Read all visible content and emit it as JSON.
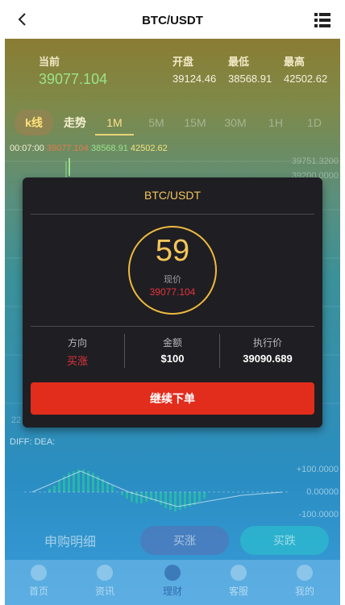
{
  "header": {
    "title": "BTC/USDT",
    "back_icon": "chevron-left-icon",
    "menu_icon": "list-menu-icon"
  },
  "stats": {
    "current_label": "当前",
    "current_value": "39077.104",
    "open_label": "开盘",
    "open_value": "39124.46",
    "low_label": "最低",
    "low_value": "38568.91",
    "high_label": "最高",
    "high_value": "42502.62"
  },
  "tabs": [
    "k线",
    "走势",
    "1M",
    "5M",
    "15M",
    "30M",
    "1H",
    "1D"
  ],
  "active_tab": "1M",
  "chart_info": {
    "time": "00:07:00",
    "v1": "39077.104",
    "v3": "38568.91",
    "v4": "42502.62",
    "price_ticks": [
      "39751.3200",
      "39200.0000"
    ],
    "y_bottom": "22"
  },
  "macd": {
    "diff_label": "DIFF:",
    "dea_label": "DEA:",
    "ticks": [
      "+100.0000",
      "0.00000",
      "-100.0000"
    ]
  },
  "modal": {
    "title": "BTC/USDT",
    "countdown": "59",
    "price_label": "现价",
    "price_value": "39077.104",
    "direction_label": "方向",
    "direction_value": "买涨",
    "amount_label": "金额",
    "amount_value": "$100",
    "exec_label": "执行价",
    "exec_value": "39090.689",
    "continue_label": "继续下单"
  },
  "bottom": {
    "title": "申购明细",
    "buy_up": "买涨",
    "buy_down": "买跌"
  },
  "nav": [
    {
      "label": "首页",
      "icon": "home-icon"
    },
    {
      "label": "资讯",
      "icon": "news-icon"
    },
    {
      "label": "理财",
      "icon": "finance-icon"
    },
    {
      "label": "客服",
      "icon": "support-icon"
    },
    {
      "label": "我的",
      "icon": "profile-icon"
    }
  ],
  "colors": {
    "accent_gold": "#f4c65a",
    "up_red": "#e22c1c",
    "green": "#9be38b"
  }
}
